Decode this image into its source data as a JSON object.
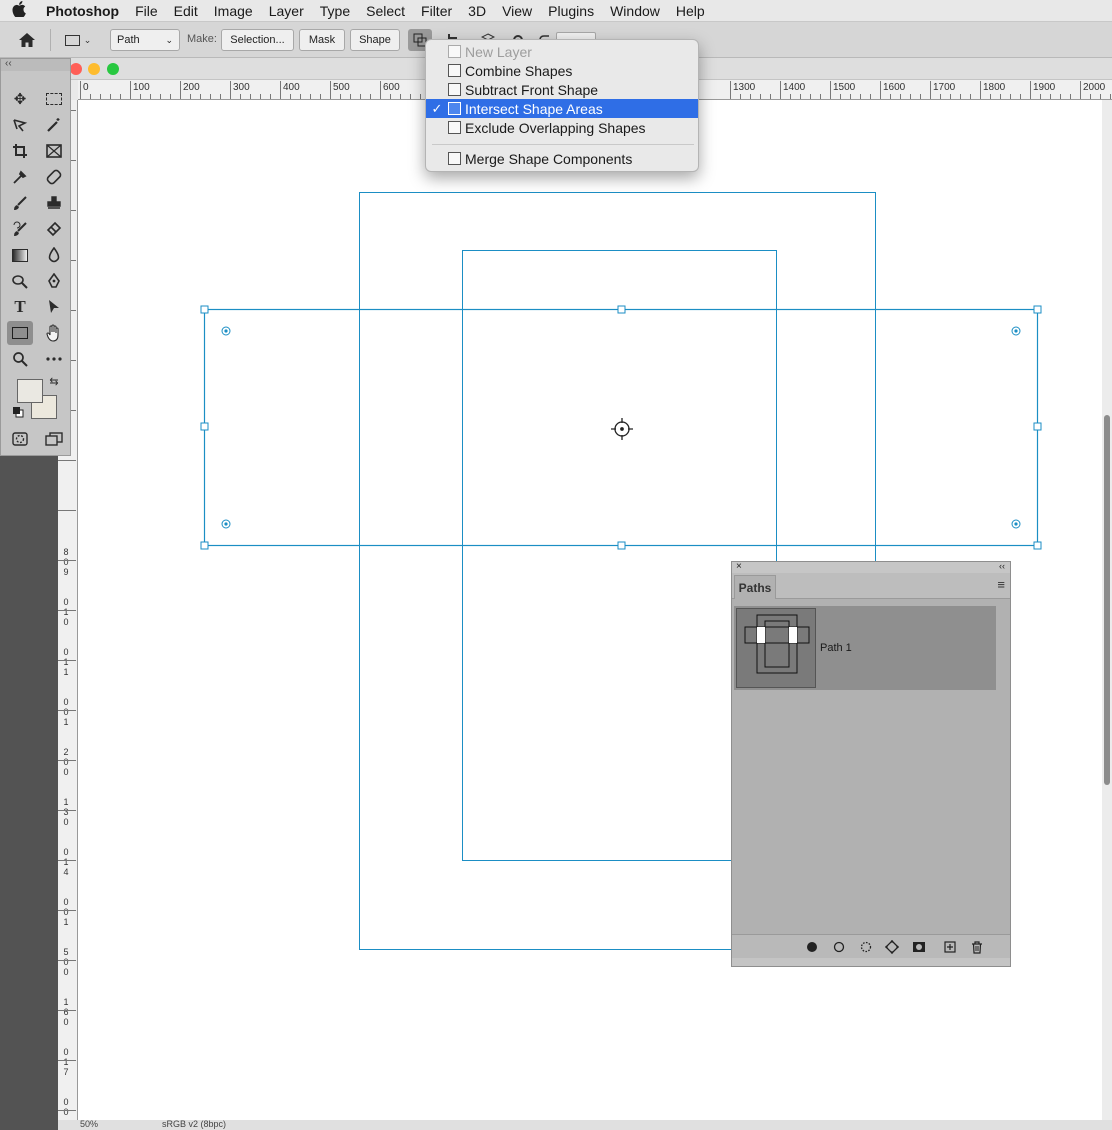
{
  "menubar": {
    "apple": "",
    "app": "Photoshop",
    "items": [
      "File",
      "Edit",
      "Image",
      "Layer",
      "Type",
      "Select",
      "Filter",
      "3D",
      "View",
      "Plugins",
      "Window",
      "Help"
    ]
  },
  "options": {
    "mode_value": "Path",
    "make_label": "Make:",
    "selection_label": "Selection...",
    "mask_label": "Mask",
    "shape_label": "Shape"
  },
  "ruler": {
    "h_labels": [
      "0",
      "100",
      "200",
      "300",
      "400",
      "500",
      "600",
      "1300",
      "1400",
      "1500",
      "1600",
      "1700",
      "1800",
      "1900",
      "2000"
    ],
    "v_labels": [
      "8",
      "0",
      "9",
      "0",
      "1",
      "0",
      "0",
      "1",
      "1",
      "0",
      "0",
      "1",
      "2",
      "0",
      "0",
      "1",
      "3",
      "0",
      "0",
      "1",
      "4",
      "0",
      "0",
      "1",
      "5",
      "0",
      "0",
      "1",
      "6",
      "0",
      "0",
      "1",
      "7",
      "0",
      "0",
      "1",
      "8",
      "0",
      "0",
      "1",
      "9",
      "0",
      "0"
    ]
  },
  "status": {
    "zoom": "50%",
    "profile": "sRGB v2 (8bpc)"
  },
  "dropdown": {
    "items": [
      {
        "label": "New Layer",
        "state": "disabled"
      },
      {
        "label": "Combine Shapes",
        "state": "normal"
      },
      {
        "label": "Subtract Front Shape",
        "state": "normal"
      },
      {
        "label": "Intersect Shape Areas",
        "state": "selected"
      },
      {
        "label": "Exclude Overlapping Shapes",
        "state": "normal"
      },
      {
        "label": "Merge Shape Components",
        "state": "normal"
      }
    ],
    "checkmark": "✓"
  },
  "paths_panel": {
    "tab": "Paths",
    "path_name": "Path 1",
    "close_glyph": "×",
    "collapse_glyph": "‹‹",
    "menu_glyph": "≡"
  },
  "toolbox": {
    "collapse_glyph": "‹‹"
  },
  "colors": {
    "selection_blue": "#2f6ee6",
    "path_cyan": "#1b8ec4",
    "foreground": "#eae8e2",
    "background": "#ece8dd"
  }
}
